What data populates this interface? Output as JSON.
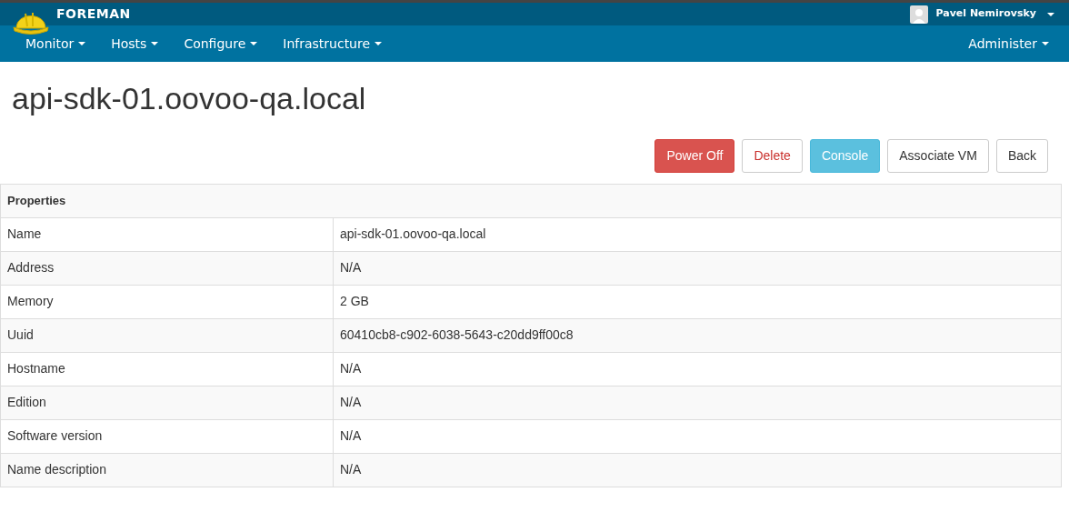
{
  "brand": "FOREMAN",
  "user": {
    "name": "Pavel Nemirovsky"
  },
  "menu": [
    {
      "label": "Monitor"
    },
    {
      "label": "Hosts"
    },
    {
      "label": "Configure"
    },
    {
      "label": "Infrastructure"
    }
  ],
  "right_menu": [
    {
      "label": "Administer"
    }
  ],
  "title": "api-sdk-01.oovoo-qa.local",
  "buttons": [
    {
      "label": "Power Off",
      "kind": "danger"
    },
    {
      "label": "Delete",
      "kind": "delete"
    },
    {
      "label": "Console",
      "kind": "info"
    },
    {
      "label": "Associate VM",
      "kind": "default"
    },
    {
      "label": "Back",
      "kind": "default"
    }
  ],
  "table": {
    "heading": "Properties",
    "rows": [
      {
        "name": "Name",
        "value": "api-sdk-01.oovoo-qa.local"
      },
      {
        "name": "Address",
        "value": "N/A"
      },
      {
        "name": "Memory",
        "value": "2 GB"
      },
      {
        "name": "Uuid",
        "value": "60410cb8-c902-6038-5643-c20dd9ff00c8"
      },
      {
        "name": "Hostname",
        "value": "N/A"
      },
      {
        "name": "Edition",
        "value": "N/A"
      },
      {
        "name": "Software version",
        "value": "N/A"
      },
      {
        "name": "Name description",
        "value": "N/A"
      }
    ]
  }
}
